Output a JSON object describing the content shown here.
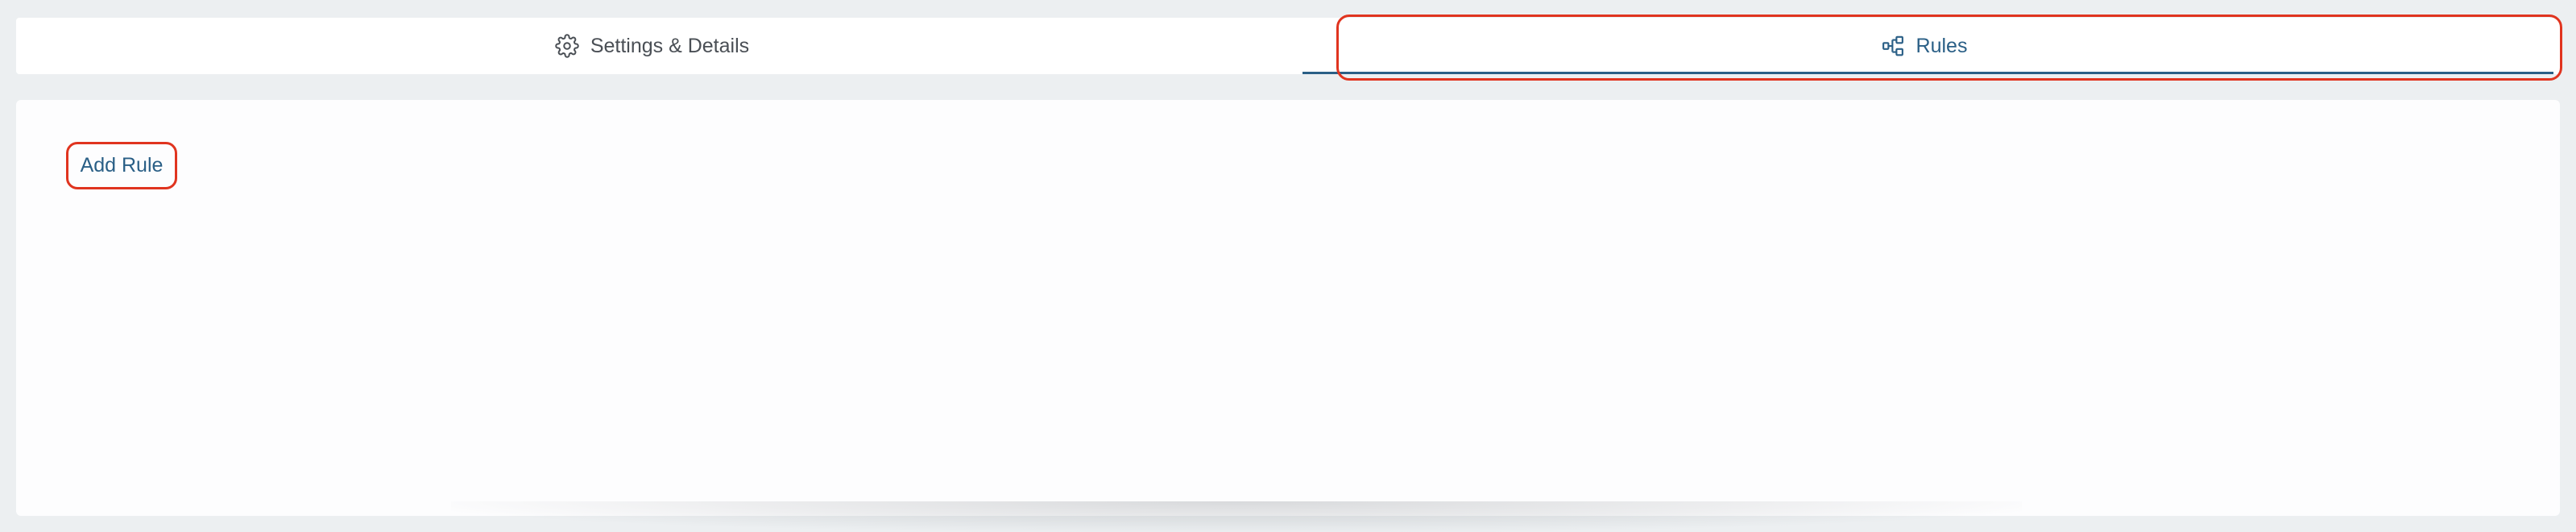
{
  "tabs": [
    {
      "label": "Settings & Details",
      "icon": "gear-icon",
      "active": false
    },
    {
      "label": "Rules",
      "icon": "hierarchy-icon",
      "active": true
    }
  ],
  "rules_panel": {
    "add_rule_label": "Add Rule"
  },
  "colors": {
    "accent": "#2a5f86",
    "highlight": "#e0341f",
    "background": "#eceff1",
    "text": "#4a4f55"
  }
}
